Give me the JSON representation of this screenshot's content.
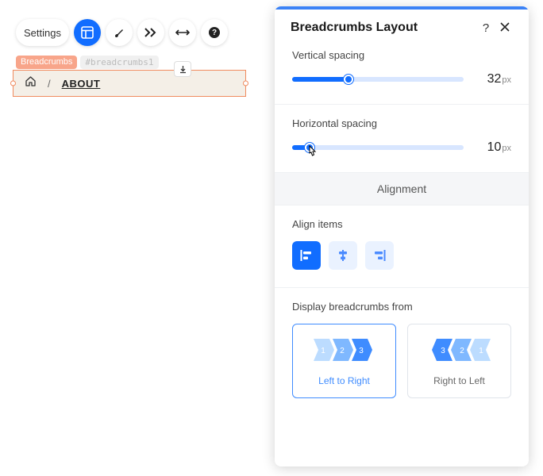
{
  "toolbar": {
    "settings_label": "Settings"
  },
  "element": {
    "name": "Breadcrumbs",
    "id": "#breadcrumbs1",
    "crumbs": {
      "current": "ABOUT",
      "separator": "/"
    }
  },
  "panel": {
    "title": "Breadcrumbs Layout",
    "vertical": {
      "label": "Vertical spacing",
      "value": "32",
      "unit": "px",
      "percent": 33
    },
    "horizontal": {
      "label": "Horizontal spacing",
      "value": "10",
      "unit": "px",
      "percent": 10
    },
    "alignment": {
      "group": "Alignment",
      "label": "Align items"
    },
    "direction": {
      "label": "Display breadcrumbs from",
      "ltr": "Left to Right",
      "rtl": "Right to Left"
    }
  }
}
